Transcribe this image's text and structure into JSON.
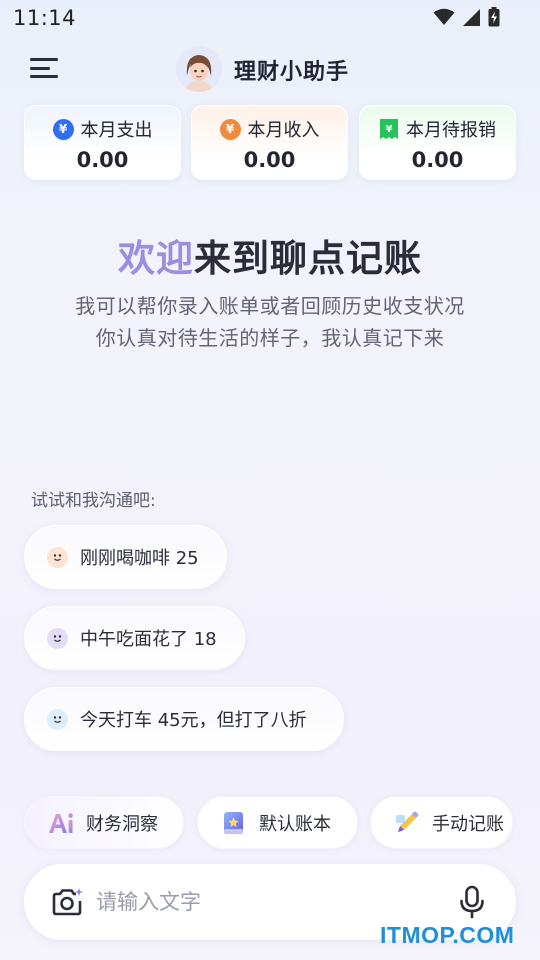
{
  "status_bar": {
    "time": "11:14",
    "icons": [
      "wifi-icon",
      "signal-icon",
      "battery-charging-icon"
    ]
  },
  "header": {
    "menu_icon": "menu-icon",
    "title": "理财小助手"
  },
  "summary_cards": [
    {
      "label": "本月支出",
      "value": "0.00",
      "icon": "yuan-coin-icon",
      "accent": "#2f6ef2"
    },
    {
      "label": "本月收入",
      "value": "0.00",
      "icon": "yuan-coin-icon",
      "accent": "#f08a3c"
    },
    {
      "label": "本月待报销",
      "value": "0.00",
      "icon": "receipt-icon",
      "accent": "#27c25a"
    }
  ],
  "welcome": {
    "title_highlight": "欢迎",
    "title_rest": "来到聊点记账",
    "line1": "我可以帮你录入账单或者回顾历史收支状况",
    "line2": "你认真对待生活的样子，我认真记下来",
    "highlight_color": "#9b8ee0"
  },
  "suggestions": {
    "label": "试试和我沟通吧:",
    "items": [
      {
        "text": "刚刚喝咖啡 25",
        "icon": "smile-icon",
        "icon_color": "#fde3d4"
      },
      {
        "text": "中午吃面花了 18",
        "icon": "smile-icon",
        "icon_color": "#e3ddf8"
      },
      {
        "text": "今天打车 45元，但打了八折",
        "icon": "smile-icon",
        "icon_color": "#dbeefa"
      }
    ]
  },
  "quick_actions": [
    {
      "label": "财务洞察",
      "icon": "ai-icon"
    },
    {
      "label": "默认账本",
      "icon": "book-icon"
    },
    {
      "label": "手动记账",
      "icon": "pencil-icon"
    }
  ],
  "input": {
    "placeholder": "请输入文字",
    "camera_icon": "camera-icon",
    "mic_icon": "microphone-icon"
  },
  "watermark": "ITMOP.COM"
}
